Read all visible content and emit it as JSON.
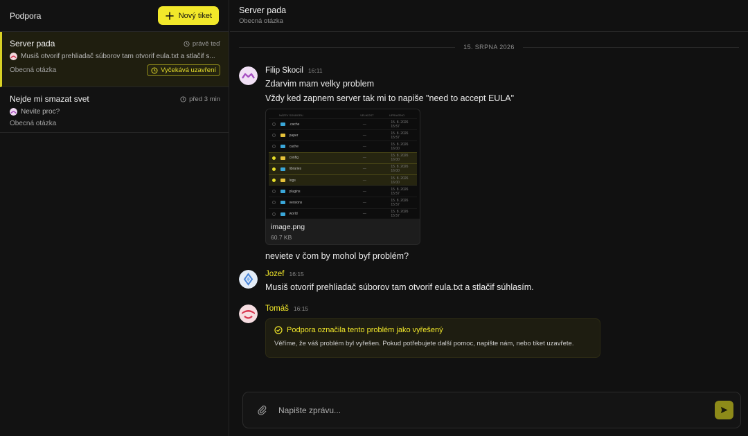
{
  "sidebar": {
    "title": "Podpora",
    "new_ticket_label": "Nový tiket",
    "tickets": [
      {
        "title": "Server pada",
        "time": "právě teď",
        "preview": "Musiš otvorif prehliadač súborov tam otvorif eula.txt a stlačif s...",
        "category": "Obecná otázka",
        "status": "Vyčekává uzavření"
      },
      {
        "title": "Nejde mi smazat svet",
        "time": "před 3 min",
        "preview": "Nevite proc?",
        "category": "Obecná otázka"
      }
    ]
  },
  "header": {
    "title": "Server pada",
    "subtitle": "Obecná otázka"
  },
  "date_separator": "15. SRPNA 2026",
  "messages": [
    {
      "author": "Filip Skocil",
      "time": "16:11",
      "lines": [
        "Zdarvim mam velky problem",
        "Vždy ked zapnem server tak mi to napiše \"need to accept EULA\""
      ],
      "attachment": {
        "name": "image.png",
        "size": "60.7 KB",
        "preview_columns": [
          "NÁZEV SOUBORU",
          "VELIKOST",
          "UPRAVENO"
        ],
        "preview_rows": [
          {
            "name": ".cache",
            "size": "—",
            "date": "15. 8. 2026 15:57",
            "color": "#3aa7d9",
            "checked": false
          },
          {
            "name": "paper",
            "size": "—",
            "date": "15. 8. 2026 15:57",
            "color": "#e6c23a",
            "checked": false
          },
          {
            "name": "cache",
            "size": "—",
            "date": "15. 8. 2026 16:00",
            "color": "#3aa7d9",
            "checked": false
          },
          {
            "name": "config",
            "size": "—",
            "date": "15. 8. 2026 16:00",
            "color": "#e6c23a",
            "checked": true
          },
          {
            "name": "libraries",
            "size": "—",
            "date": "15. 8. 2026 16:00",
            "color": "#3aa7d9",
            "checked": true
          },
          {
            "name": "logs",
            "size": "—",
            "date": "15. 8. 2026 16:00",
            "color": "#e6c23a",
            "checked": true
          },
          {
            "name": "plugins",
            "size": "—",
            "date": "15. 8. 2026 15:57",
            "color": "#3aa7d9",
            "checked": false
          },
          {
            "name": "versions",
            "size": "—",
            "date": "15. 8. 2026 15:57",
            "color": "#3aa7d9",
            "checked": false
          },
          {
            "name": "world",
            "size": "—",
            "date": "15. 8. 2026 15:57",
            "color": "#3aa7d9",
            "checked": false
          }
        ]
      },
      "after_text": "neviete v čom by mohol byf problém?"
    },
    {
      "author": "Jozef",
      "time": "16:15",
      "text": "Musiš otvorif prehliadač súborov tam otvorif eula.txt a stlačif súhlasím."
    },
    {
      "author": "Tomáš",
      "time": "16:15",
      "resolved_title": "Podpora označila tento problém jako vyřešený",
      "resolved_text": "Věříme, že váš problém byl vyřešen. Pokud potřebujete další pomoc, napište nám, nebo tiket uzavřete."
    }
  ],
  "composer": {
    "placeholder": "Napište zprávu..."
  },
  "colors": {
    "accent": "#f2e82a",
    "background": "#111111",
    "sidebar_active": "#1f1e0f"
  }
}
